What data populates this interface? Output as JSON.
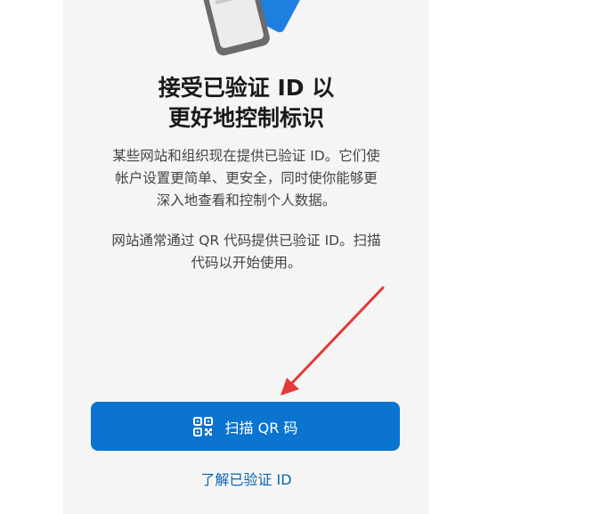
{
  "header": {
    "title_line1": "接受已验证 ID 以",
    "title_line2": "更好地控制标识"
  },
  "description": {
    "para1_line1": "某些网站和组织现在提供已验证 ID。它们使",
    "para1_line2": "帐户设置更简单、更安全，同时使你能够更",
    "para1_line3": "深入地查看和控制个人数据。",
    "para2_line1": "网站通常通过 QR 代码提供已验证 ID。扫描",
    "para2_line2": "代码以开始使用。"
  },
  "actions": {
    "scan_label": "扫描 QR 码",
    "learn_label": "了解已验证 ID"
  },
  "icons": {
    "scan_button": "qr-code-icon",
    "illustration": "phone-card-illustration",
    "annotation": "red-arrow"
  },
  "colors": {
    "primary": "#0a74d0",
    "link": "#0a64b5",
    "annotation": "#e53935"
  }
}
